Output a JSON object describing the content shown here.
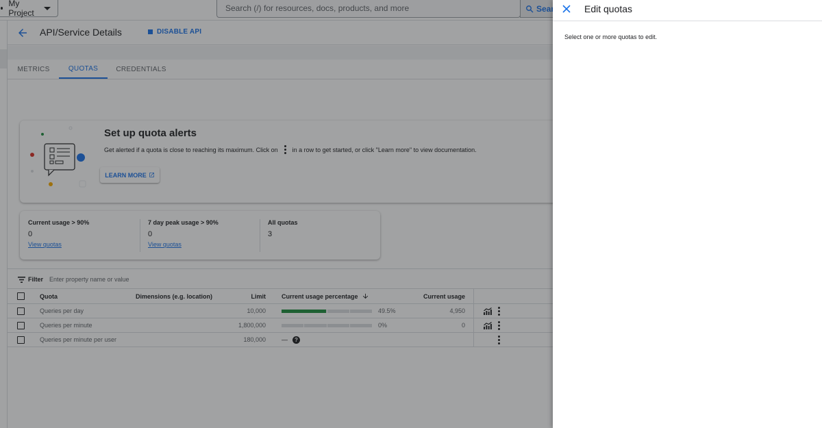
{
  "topbar": {
    "project_label": "My Project",
    "search_placeholder": "Search (/) for resources, docs, products, and more",
    "search_button_label": "Sear"
  },
  "header": {
    "title": "API/Service Details",
    "disable_label": "DISABLE API"
  },
  "tabs": [
    {
      "label": "METRICS",
      "active": false
    },
    {
      "label": "QUOTAS",
      "active": true
    },
    {
      "label": "CREDENTIALS",
      "active": false
    }
  ],
  "alert": {
    "title": "Set up quota alerts",
    "desc_before": "Get alerted if a quota is close to reaching its maximum. Click on",
    "desc_after": "in a row to get started, or click \"Learn more\" to view documentation.",
    "learn_more": "LEARN MORE"
  },
  "stats": [
    {
      "label": "Current usage > 90%",
      "value": "0",
      "link": "View quotas"
    },
    {
      "label": "7 day peak usage > 90%",
      "value": "0",
      "link": "View quotas"
    },
    {
      "label": "All quotas",
      "value": "3",
      "link": ""
    }
  ],
  "filter": {
    "label": "Filter",
    "placeholder": "Enter property name or value"
  },
  "table": {
    "headers": {
      "quota": "Quota",
      "dimensions": "Dimensions (e.g. location)",
      "limit": "Limit",
      "usage_pct": "Current usage percentage",
      "usage": "Current usage"
    },
    "rows": [
      {
        "quota": "Queries per day",
        "limit": "10,000",
        "usage_pct": "49.5%",
        "usage_fraction": 0.495,
        "usage": "4,950",
        "has_chart": true,
        "no_data": false
      },
      {
        "quota": "Queries per minute",
        "limit": "1,800,000",
        "usage_pct": "0%",
        "usage_fraction": 0,
        "usage": "0",
        "has_chart": true,
        "no_data": false
      },
      {
        "quota": "Queries per minute per user",
        "limit": "180,000",
        "usage_pct": "—",
        "usage_fraction": null,
        "usage": "",
        "has_chart": false,
        "no_data": true
      }
    ]
  },
  "panel": {
    "title": "Edit quotas",
    "message": "Select one or more quotas to edit."
  },
  "colors": {
    "accent": "#1a73e8",
    "usage_bar": "#1e8e3e",
    "track": "#dadce0"
  }
}
